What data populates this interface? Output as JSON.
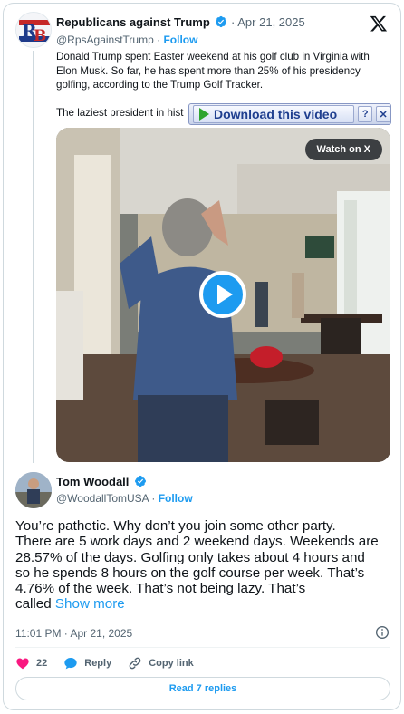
{
  "colors": {
    "accent": "#1d9bf0",
    "muted": "#536471",
    "like": "#f91880"
  },
  "original": {
    "author_name": "Republicans against Trump",
    "dot": "·",
    "date": "Apr 21, 2025",
    "handle": "@RpsAgainstTrump",
    "follow_sep": "·",
    "follow_label": "Follow",
    "paragraph1_lines": [
      "Donald Trump spent Easter weekend at his golf club in Virginia with",
      "Elon Musk. So far, he has spent more than 25% of his presidency",
      "golfing, according to the Trump Golf Tracker."
    ],
    "paragraph2": "The laziest president in hist",
    "video": {
      "watch_label": "Watch on X"
    }
  },
  "download_overlay": {
    "label": "Download this video",
    "help_label": "?",
    "close_label": "✕"
  },
  "reply": {
    "author_name": "Tom Woodall",
    "handle": "@WoodallTomUSA",
    "follow_sep": "·",
    "follow_label": "Follow",
    "text_lines": [
      "You’re pathetic. Why don’t you join some other party.",
      "There are 5 work days and 2 weekend days. Weekends are",
      "28.57% of the days. Golfing only takes about 4 hours and",
      "so he spends 8 hours on the golf course per week. That’s",
      "4.76% of the week. That’s not being lazy. That’s"
    ],
    "last_line_text": "called",
    "show_more_label": "Show more",
    "timestamp": "11:01 PM · Apr 21, 2025",
    "likes_count": "22",
    "reply_label": "Reply",
    "copy_link_label": "Copy link",
    "read_replies_label": "Read 7 replies"
  }
}
